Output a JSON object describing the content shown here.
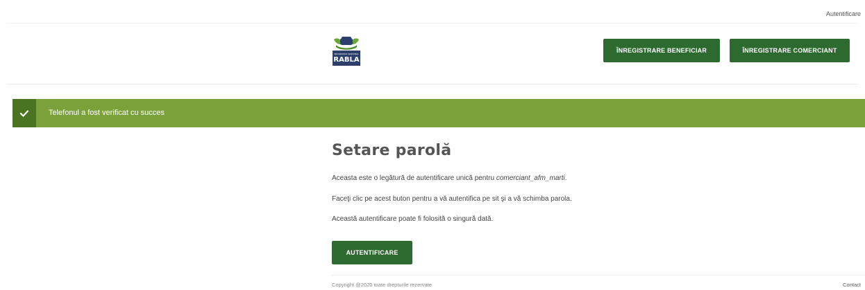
{
  "topbar": {
    "auth_link": "Autentificare"
  },
  "header": {
    "logo_text_top": "PROGRAMUL NAȚIONAL",
    "logo_text_main": "RABLA",
    "register_beneficiary": "ÎNREGISTRARE BENEFICIAR",
    "register_merchant": "ÎNREGISTRARE COMERCIANT"
  },
  "alert": {
    "message": "Telefonul a fost verificat cu succes",
    "icon": "check-icon"
  },
  "main": {
    "title": "Setare parolă",
    "p1_prefix": "Aceasta este o legătură de autentificare unică pentru ",
    "p1_username": "comerciant_afm_marti",
    "p1_suffix": ".",
    "p2": "Faceţi clic pe acest buton pentru a vă autentifica pe sit şi a vă schimba parola.",
    "p3": "Această autentificare poate fi folosită o singură dată.",
    "auth_button": "AUTENTIFICARE"
  },
  "footer": {
    "copyright": "Copyright @2020 toate drepturile rezervate",
    "contact": "Contact"
  },
  "colors": {
    "primary_button": "#2d6a2f",
    "alert_bg": "#7ba23a",
    "alert_icon_bg": "#4a7421"
  }
}
